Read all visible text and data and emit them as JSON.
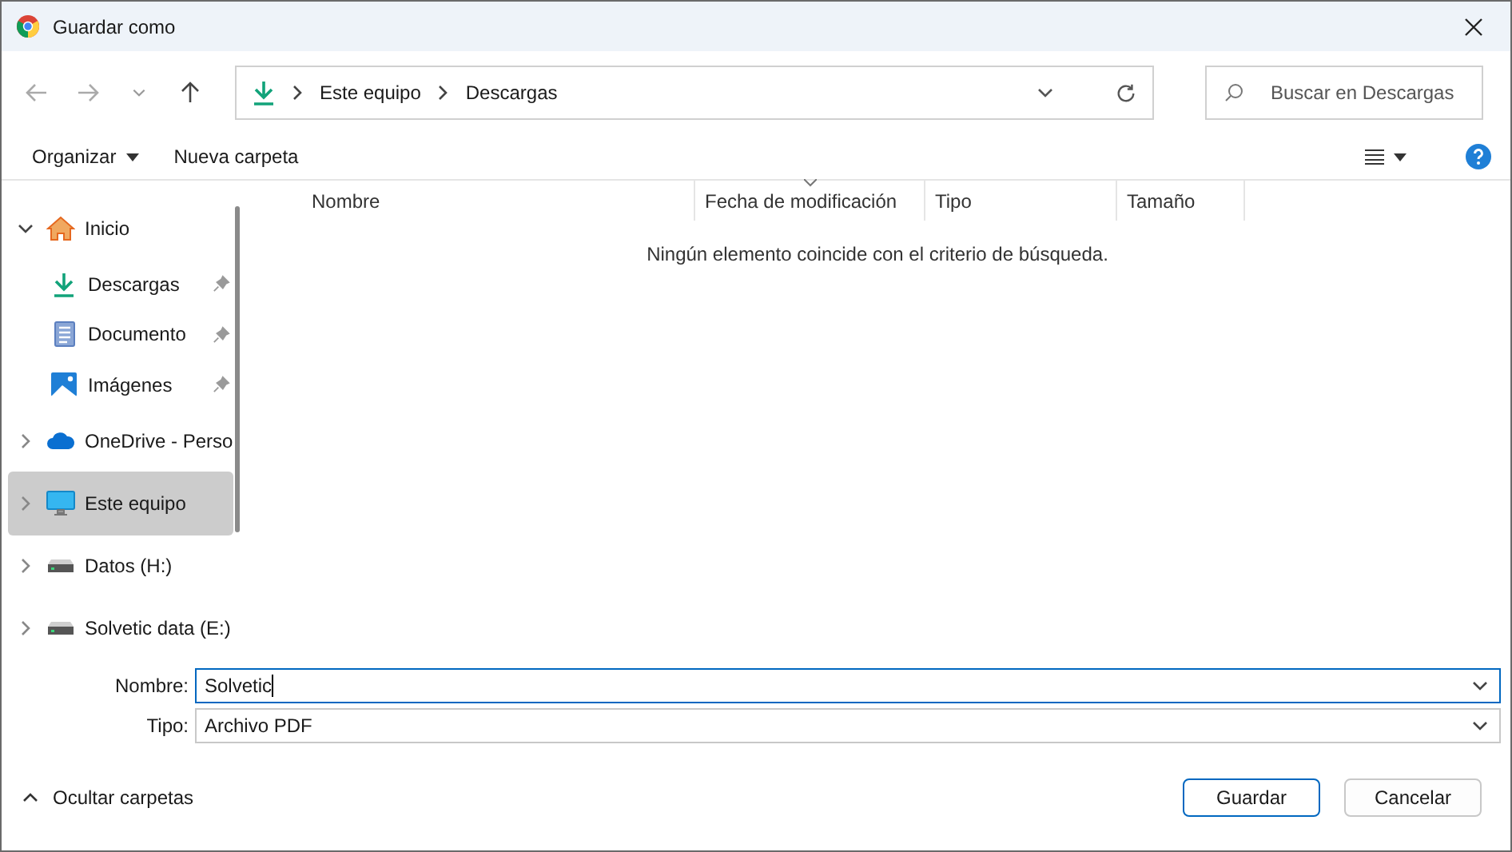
{
  "window": {
    "title": "Guardar como"
  },
  "address": {
    "path": [
      "Este equipo",
      "Descargas"
    ]
  },
  "search": {
    "placeholder": "Buscar en Descargas"
  },
  "toolbar": {
    "organize": "Organizar",
    "new_folder": "Nueva carpeta"
  },
  "sidebar": {
    "items": [
      {
        "label": "Inicio",
        "kind": "home",
        "expanded": true,
        "selected": false,
        "children": [
          {
            "label": "Descargas",
            "kind": "download",
            "pinned": true,
            "selected": false
          },
          {
            "label": "Documento",
            "kind": "document",
            "pinned": true,
            "selected": false
          },
          {
            "label": "Imágenes",
            "kind": "image",
            "pinned": true,
            "selected": false
          }
        ]
      },
      {
        "label": "OneDrive - Perso",
        "kind": "cloud",
        "expanded": false,
        "selected": false
      },
      {
        "label": "Este equipo",
        "kind": "computer",
        "expanded": false,
        "selected": true
      },
      {
        "label": "Datos (H:)",
        "kind": "drive",
        "expanded": false,
        "selected": false
      },
      {
        "label": "Solvetic data (E:)",
        "kind": "drive",
        "expanded": false,
        "selected": false
      }
    ]
  },
  "table": {
    "columns": [
      {
        "label": "Nombre",
        "sorted": false
      },
      {
        "label": "Fecha de modificación",
        "sorted": true
      },
      {
        "label": "Tipo",
        "sorted": false
      },
      {
        "label": "Tamaño",
        "sorted": false
      }
    ],
    "empty_message": "Ningún elemento coincide con el criterio de búsqueda."
  },
  "form": {
    "fields": [
      {
        "label": "Nombre:",
        "value": "Solvetic",
        "focused": true
      },
      {
        "label": "Tipo:",
        "value": "Archivo PDF",
        "focused": false
      }
    ]
  },
  "footer": {
    "toggle": "Ocultar carpetas",
    "buttons": [
      {
        "label": "Guardar",
        "primary": true
      },
      {
        "label": "Cancelar",
        "primary": false
      }
    ]
  }
}
